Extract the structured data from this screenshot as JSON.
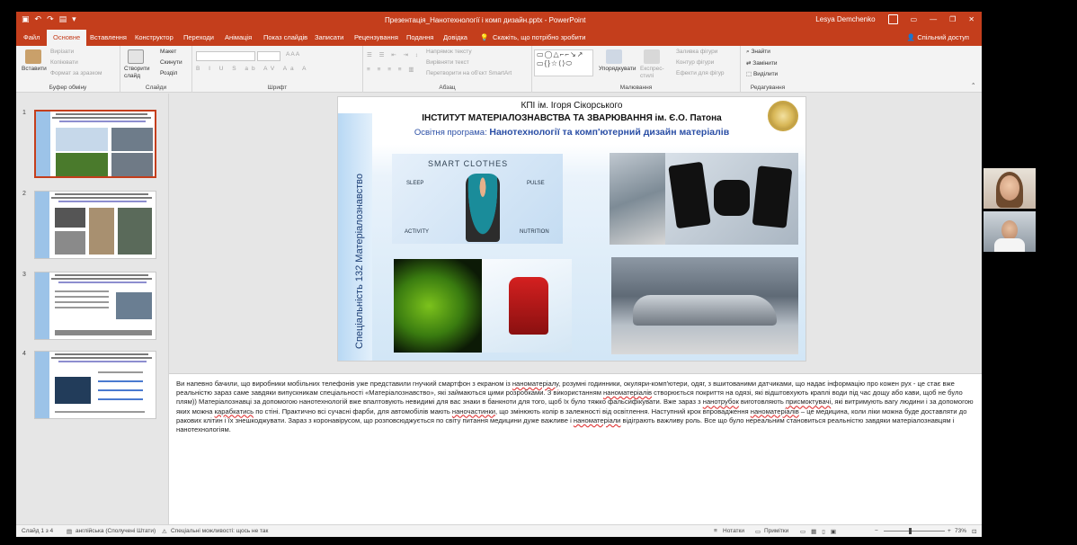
{
  "window": {
    "title": "Презентація_Нанотехнології і комп дизайн.pptx - PowerPoint",
    "user": "Lesya Demchenko"
  },
  "tabs": [
    "Файл",
    "Основне",
    "Вставлення",
    "Конструктор",
    "Переходи",
    "Анімація",
    "Показ слайдів",
    "Записати",
    "Рецензування",
    "Подання",
    "Довідка"
  ],
  "tell_me": "Скажіть, що потрібно зробити",
  "share": "Спільний доступ",
  "ribbon": {
    "clipboard": {
      "label": "Буфер обміну",
      "paste": "Вставити",
      "cut": "Вирізати",
      "copy": "Копіювати",
      "format_painter": "Формат за зразком"
    },
    "slides": {
      "label": "Слайди",
      "new_slide": "Створити слайд",
      "layout": "Макет",
      "reset": "Скинути",
      "section": "Розділ"
    },
    "font": {
      "label": "Шрифт"
    },
    "paragraph": {
      "label": "Абзац",
      "text_direction": "Напрямок тексту",
      "align_text": "Вирівняти текст",
      "smartart": "Перетворити на об'єкт SmartArt"
    },
    "drawing": {
      "label": "Малювання",
      "arrange": "Упорядкувати",
      "quick_styles": "Експрес-стилі",
      "fill": "Заливка фігури",
      "outline": "Контур фігури",
      "effects": "Ефекти для фігур"
    },
    "editing": {
      "label": "Редагування",
      "find": "Знайти",
      "replace": "Замінити",
      "select": "Виділити"
    }
  },
  "thumbnails": [
    {
      "num": "1"
    },
    {
      "num": "2"
    },
    {
      "num": "3"
    },
    {
      "num": "4"
    }
  ],
  "slide": {
    "line1": "КПІ ім. Ігоря Сікорського",
    "line2": "ІНСТИТУТ МАТЕРІАЛОЗНАВСТВА ТА ЗВАРЮВАННЯ ім. Є.О. Патона",
    "program_label": "Освітня програма: ",
    "program_name": "Нанотехнології та комп'ютерний дизайн матеріалів",
    "vertical": "Спеціальність 132 Матеріалознавство",
    "smart_title": "SMART CLOTHES",
    "smart_icons": [
      "SLEEP",
      "PULSE",
      "ACTIVITY",
      "NUTRITION"
    ]
  },
  "notes": {
    "p1": "Ви напевно бачили, що  виробники мобільних телефонів уже представили гнучкий смартфон з екраном із ",
    "s1": "наноматеріалу",
    "p2": ", розумні годинники, окуляри-комп'ютери,  одяг, з вшитованими датчиками, що надає інформацію про кожен рух - це стає вже реальністю зараз саме завдяки випускникам спеціальності «Матеріалознавство»,  які займаються цими розробками.  З використанням ",
    "s2": "наноматеріалів",
    "p3": " створюється покриття на одязі, які відштовхують краплі води під час дощу або кави, щоб не було плям))  Матеріалознавці за допомогою нанотехнологій вже  впалтовують невидимі для вас знаки в банкноти для того, щоб їх було тяжко фальсифікувати. Вже зараз з ",
    "s3": "нанотрубок",
    "p4": " виготовляють ",
    "s4": "присмоктувачі",
    "p5": ", які витримують вагу людини і за допомогою яких можна ",
    "s5": "карабкатись",
    "p6": " по стіні.  Практично всі сучасні фарби, для автомобілів мають ",
    "s6": "наночастинки",
    "p7": ",  що змінюють колір в залежності від освітлення. Наступний крок впровадження ",
    "s7": "наноматеріалів",
    "p8": " – це медицина, коли ліки можна буде доставляти до ракових клітин і їх знешкоджувати. Зараз з коронавірусом, що розповсюджується по світу питання медицини дуже важливе і ",
    "s8": "наноматеріали",
    "p9": " відіграють важливу роль. Все що було нереальним становиться реальністю завдяки матеріалознавцям і нанотехнологіям."
  },
  "status": {
    "slide": "Слайд 1 з 4",
    "language": "англійська (Сполучені Штати)",
    "accessibility": "Спеціальні можливості: щось не так",
    "notes": "Нотатки",
    "comments": "Примітки",
    "zoom": "73%"
  }
}
